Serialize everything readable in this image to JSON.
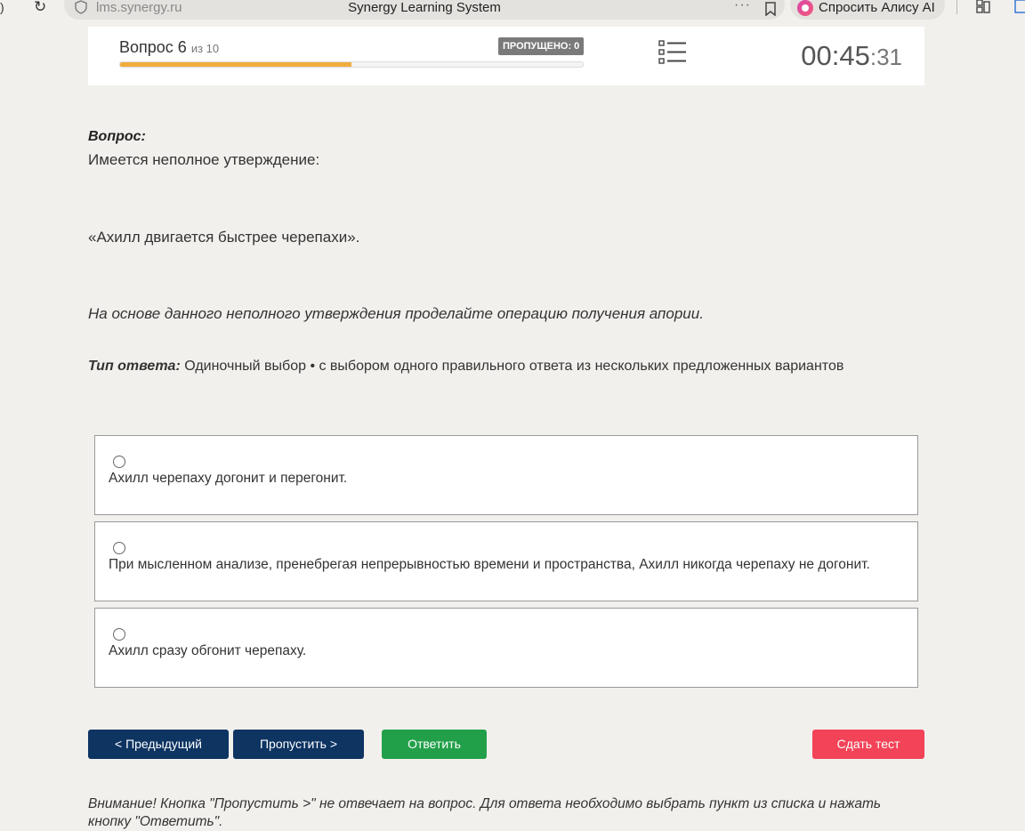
{
  "browser": {
    "url_host": "lms.synergy.ru",
    "page_title": "Synergy Learning System",
    "alice_label": "Спросить Алису AI",
    "more_dots": "···"
  },
  "header": {
    "question_label": "Вопрос 6",
    "question_of": "из 10",
    "skipped_badge": "ПРОПУЩЕНО: 0",
    "progress": 0.5,
    "progress_color": "#f0ad3e",
    "timer_main": "00:45",
    "timer_sec": ":31"
  },
  "question": {
    "heading": "Вопрос:",
    "line1": "Имеется неполное утверждение:",
    "line2": "«Ахилл двигается быстрее черепахи».",
    "line3": "На основе данного неполного утверждения проделайте операцию получения апории.",
    "answer_type_label": "Тип ответа:",
    "answer_type_value": " Одиночный выбор • с выбором одного правильного ответа из нескольких предложенных вариантов"
  },
  "options": [
    {
      "text": "Ахилл черепаху догонит и перегонит."
    },
    {
      "text": "При мысленном анализе, пренебрегая непрерывностью времени и пространства, Ахилл никогда черепаху не догонит."
    },
    {
      "text": "Ахилл сразу обгонит черепаху."
    }
  ],
  "buttons": {
    "prev": "< Предыдущий",
    "skip": "Пропустить >",
    "answer": "Ответить",
    "submit": "Сдать тест"
  },
  "colors": {
    "nav_button": "#0e3462",
    "answer_button": "#22a049",
    "submit_button": "#f24358"
  },
  "warning": "Внимание! Кнопка \"Пропустить >\" не отвечает на вопрос. Для ответа необходимо выбрать пункт из списка и нажать кнопку \"Ответить\"."
}
